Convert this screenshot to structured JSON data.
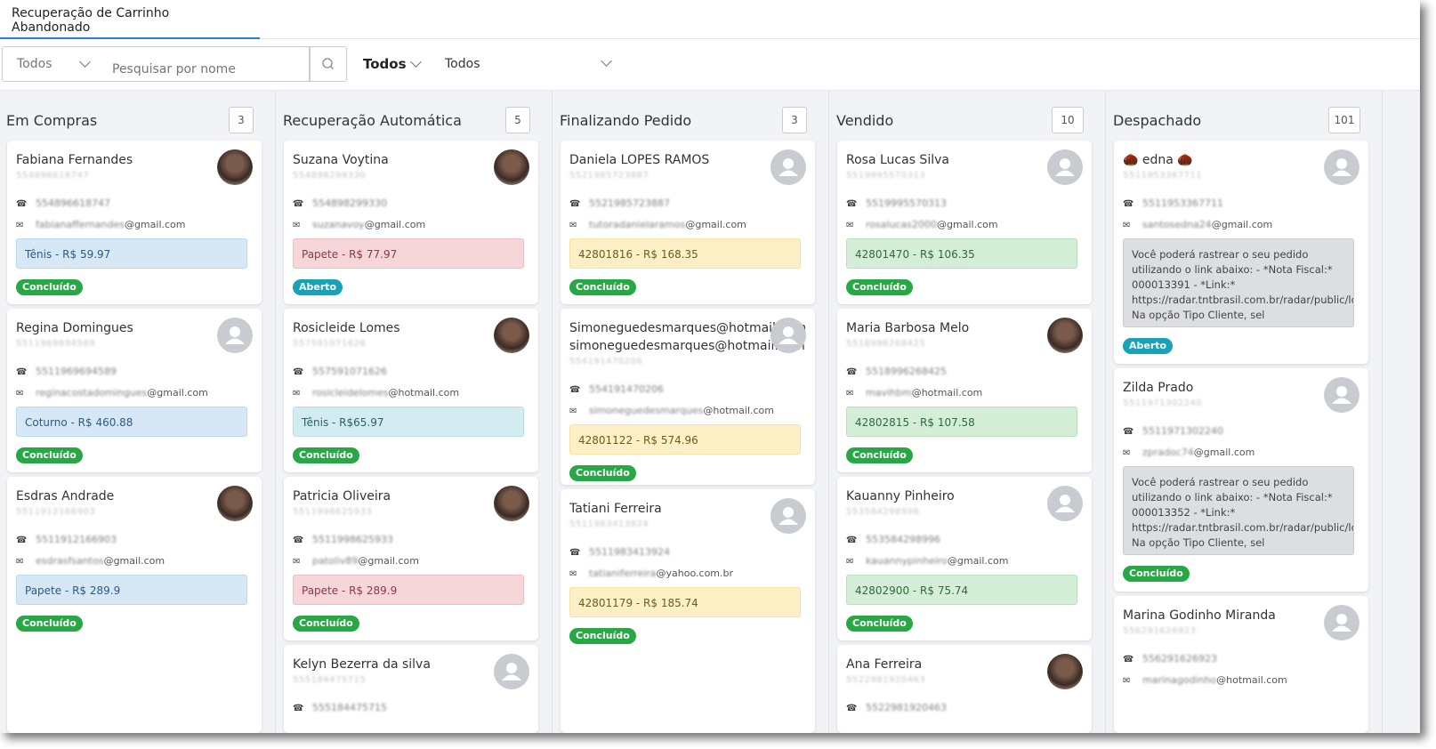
{
  "tabs": {
    "active": "Recuperação de Carrinho Abandonado"
  },
  "toolbar": {
    "status_select": "Todos",
    "search_placeholder": "Pesquisar por nome",
    "filter1": "Todos",
    "filter2": "Todos"
  },
  "columns": [
    {
      "title": "Em Compras",
      "count": "3",
      "cards": [
        {
          "name": "Fabiana Fernandes",
          "sub": "554896618747",
          "phone": "554896618747",
          "email": "fabianaffernandes@gmail.com",
          "order": "Tênis - R$ 59.97",
          "order_color": "blue",
          "status": "Concluído",
          "avatar": "photo"
        },
        {
          "name": "Regina Domingues",
          "sub": "5511969694589",
          "phone": "5511969694589",
          "email": "reginacostadomingues@gmail.com",
          "order": "Coturno - R$ 460.88",
          "order_color": "blue",
          "status": "Concluído",
          "avatar": "generic"
        },
        {
          "name": "Esdras Andrade",
          "sub": "5511912166903",
          "phone": "5511912166903",
          "email": "esdrasfsantos@gmail.com",
          "order": "Papete - R$ 289.9",
          "order_color": "blue",
          "status": "Concluído",
          "avatar": "photo"
        }
      ]
    },
    {
      "title": "Recuperação Automática",
      "count": "5",
      "cards": [
        {
          "name": "Suzana Voytina",
          "sub": "554898299330",
          "phone": "554898299330",
          "email": "suzanavoy@gmail.com",
          "order": "Papete - R$ 77.97",
          "order_color": "red",
          "status": "Aberto",
          "avatar": "photo"
        },
        {
          "name": "Rosicleide Lomes",
          "sub": "557591071626",
          "phone": "557591071626",
          "email": "rosicleidelomes@hotmail.com",
          "order": "Tênis - R$65.97",
          "order_color": "cyan",
          "status": "Concluído",
          "avatar": "photo"
        },
        {
          "name": "Patricia Oliveira",
          "sub": "5511998625933",
          "phone": "5511998625933",
          "email": "patoliv89@gmail.com",
          "order": "Papete - R$ 289.9",
          "order_color": "red",
          "status": "Concluído",
          "avatar": "photo"
        },
        {
          "name": "Kelyn Bezerra da silva",
          "sub": "555184475715",
          "phone": "555184475715",
          "email": "",
          "order": "",
          "order_color": "",
          "status": "",
          "avatar": "generic"
        }
      ]
    },
    {
      "title": "Finalizando Pedido",
      "count": "3",
      "cards": [
        {
          "name": "Daniela LOPES RAMOS",
          "sub": "5521985723887",
          "phone": "5521985723887",
          "email": "tutoradanielaramos@gmail.com",
          "order": "42801816 - R$ 168.35",
          "order_color": "yellow",
          "status": "Concluído",
          "avatar": "generic"
        },
        {
          "name": "Simoneguedesmarques@hotmail.com",
          "name2": "simoneguedesmarques@hotmail.com",
          "sub": "554191470206",
          "phone": "554191470206",
          "email": "simoneguedesmarques@hotmail.com",
          "order": "42801122 - R$ 574.96",
          "order_color": "yellow",
          "status": "Concluído",
          "avatar": "generic"
        },
        {
          "name": "Tatiani Ferreira",
          "sub": "5511983413924",
          "phone": "5511983413924",
          "email": "tatianiferreira@yahoo.com.br",
          "order": "42801179 - R$ 185.74",
          "order_color": "yellow",
          "status": "Concluído",
          "avatar": "generic"
        }
      ]
    },
    {
      "title": "Vendido",
      "count": "10",
      "cards": [
        {
          "name": "Rosa Lucas Silva",
          "sub": "5519995570313",
          "phone": "5519995570313",
          "email": "rosalucas2000@gmail.com",
          "order": "42801470 - R$ 106.35",
          "order_color": "green",
          "status": "Concluído",
          "avatar": "generic"
        },
        {
          "name": "Maria Barbosa Melo",
          "sub": "5518996268425",
          "phone": "5518996268425",
          "email": "mavihbm@hotmail.com",
          "order": "42802815 - R$ 107.58",
          "order_color": "green",
          "status": "Concluído",
          "avatar": "photo"
        },
        {
          "name": "Kauanny Pinheiro",
          "sub": "553584298996",
          "phone": "553584298996",
          "email": "kauannypinheiro@gmail.com",
          "order": "42802900 - R$ 75.74",
          "order_color": "green",
          "status": "Concluído",
          "avatar": "generic"
        },
        {
          "name": "Ana Ferreira",
          "sub": "5522981920463",
          "phone": "5522981920463",
          "email": "",
          "order": "",
          "order_color": "",
          "status": "",
          "avatar": "photo"
        }
      ]
    },
    {
      "title": "Despachado",
      "count": "101",
      "cards": [
        {
          "name": "🌰 edna 🌰",
          "sub": "5511953367711",
          "phone": "5511953367711",
          "email": "santosedna24@gmail.com",
          "message": "Você poderá rastrear o seu pedido utilizando o link abaixo: - *Nota Fiscal:* 000013391 - *Link:* https://radar.tntbrasil.com.br/radar/public/localizacao Na opção Tipo Cliente, sel",
          "status": "Aberto",
          "avatar": "generic"
        },
        {
          "name": "Zilda Prado",
          "sub": "5511971302240",
          "phone": "5511971302240",
          "email": "zpradoc74@gmail.com",
          "message": "Você poderá rastrear o seu pedido utilizando o link abaixo: - *Nota Fiscal:* 000013352 - *Link:* https://radar.tntbrasil.com.br/radar/public/localizacao Na opção Tipo Cliente, sel",
          "status": "Concluído",
          "avatar": "generic"
        },
        {
          "name": "Marina Godinho Miranda",
          "sub": "556291626923",
          "phone": "556291626923",
          "email": "marinagodinho@hotmail.com",
          "message": "",
          "status": "",
          "avatar": "generic"
        }
      ]
    }
  ],
  "icon_names": {
    "phone": "phone-icon",
    "email": "mail-icon",
    "search": "search-icon",
    "avatar": "user-icon"
  },
  "colors": {
    "accent": "#1e88c9",
    "done": "#27a844",
    "open": "#17a2b8"
  }
}
